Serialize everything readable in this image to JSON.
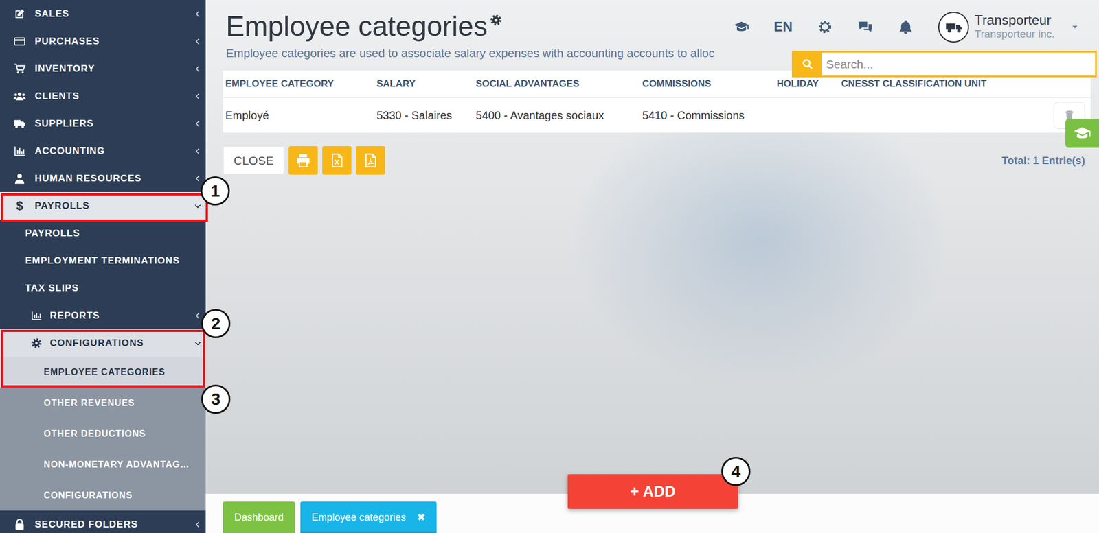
{
  "page": {
    "title": "Employee categories",
    "subtitle": "Employee categories are used to associate salary expenses with accounting accounts to alloc"
  },
  "topbar": {
    "language": "EN",
    "user": {
      "name": "Transporteur",
      "company": "Transporteur inc."
    }
  },
  "search": {
    "placeholder": "Search..."
  },
  "sidebar": {
    "items": [
      {
        "label": "SALES",
        "expanded": false
      },
      {
        "label": "PURCHASES",
        "expanded": false
      },
      {
        "label": "INVENTORY",
        "expanded": false
      },
      {
        "label": "CLIENTS",
        "expanded": false
      },
      {
        "label": "SUPPLIERS",
        "expanded": false
      },
      {
        "label": "ACCOUNTING",
        "expanded": false
      },
      {
        "label": "HUMAN RESOURCES",
        "expanded": false
      },
      {
        "label": "PAYROLLS",
        "glyph": "$",
        "expanded": true,
        "children": [
          {
            "label": "PAYROLLS",
            "kind": "link"
          },
          {
            "label": "EMPLOYMENT TERMINATIONS",
            "kind": "link"
          },
          {
            "label": "TAX SLIPS",
            "kind": "link"
          },
          {
            "label": "REPORTS",
            "kind": "group",
            "expanded": false
          },
          {
            "label": "CONFIGURATIONS",
            "kind": "group",
            "expanded": true,
            "children": [
              {
                "label": "EMPLOYEE CATEGORIES",
                "selected": true
              },
              {
                "label": "OTHER REVENUES",
                "selected": false
              },
              {
                "label": "OTHER DEDUCTIONS",
                "selected": false
              },
              {
                "label": "NON-MONETARY ADVANTAG…",
                "selected": false
              },
              {
                "label": "CONFIGURATIONS",
                "selected": false
              }
            ]
          }
        ]
      },
      {
        "label": "SECURED FOLDERS",
        "expanded": false
      }
    ]
  },
  "table": {
    "columns": [
      "EMPLOYEE CATEGORY",
      "SALARY",
      "SOCIAL ADVANTAGES",
      "COMMISSIONS",
      "HOLIDAY",
      "CNESST CLASSIFICATION UNIT"
    ],
    "rows": [
      {
        "cells": [
          "Employé",
          "5330 - Salaires",
          "5400 - Avantages sociaux",
          "5410 - Commissions",
          "",
          ""
        ]
      }
    ]
  },
  "footer": {
    "close": "CLOSE",
    "total": "Total: 1 Entrie(s)",
    "add": "+ ADD"
  },
  "tabs": [
    {
      "label": "Dashboard",
      "selected": false,
      "color": "#7dc243"
    },
    {
      "label": "Employee categories",
      "selected": true,
      "color": "#19b4e8",
      "close": "✖"
    }
  ],
  "annotations": [
    {
      "number": "1"
    },
    {
      "number": "2"
    },
    {
      "number": "3"
    },
    {
      "number": "4"
    }
  ]
}
